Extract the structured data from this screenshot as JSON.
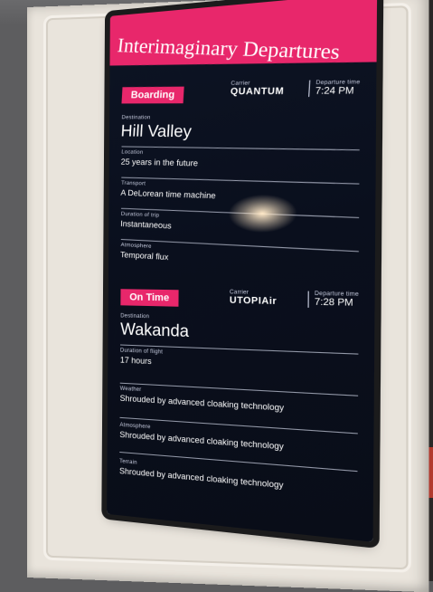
{
  "sign": {
    "title": "Interimaginary Departures"
  },
  "labels": {
    "carrier": "Carrier",
    "departure_time": "Departure time",
    "destination": "Destination",
    "location": "Location",
    "transport": "Transport",
    "duration_trip": "Duration of trip",
    "duration_flight": "Duration of flight",
    "atmosphere": "Atmosphere",
    "weather": "Weather",
    "terrain": "Terrain"
  },
  "flight1": {
    "status": "Boarding",
    "carrier": "QUANTUM",
    "time": "7:24 PM",
    "destination": "Hill Valley",
    "location": "25 years in the future",
    "transport": "A DeLorean time machine",
    "duration": "Instantaneous",
    "atmosphere": "Temporal flux"
  },
  "flight2": {
    "status": "On Time",
    "carrier": "UTOPIAir",
    "time": "7:28 PM",
    "destination": "Wakanda",
    "duration": "17 hours",
    "weather": "Shrouded by advanced cloaking technology",
    "atmosphere": "Shrouded by advanced cloaking technology",
    "terrain": "Shrouded by advanced cloaking technology"
  },
  "colors": {
    "banner": "#e8276b",
    "screen": "#0a0f1d",
    "frame": "#e9e4dc"
  }
}
